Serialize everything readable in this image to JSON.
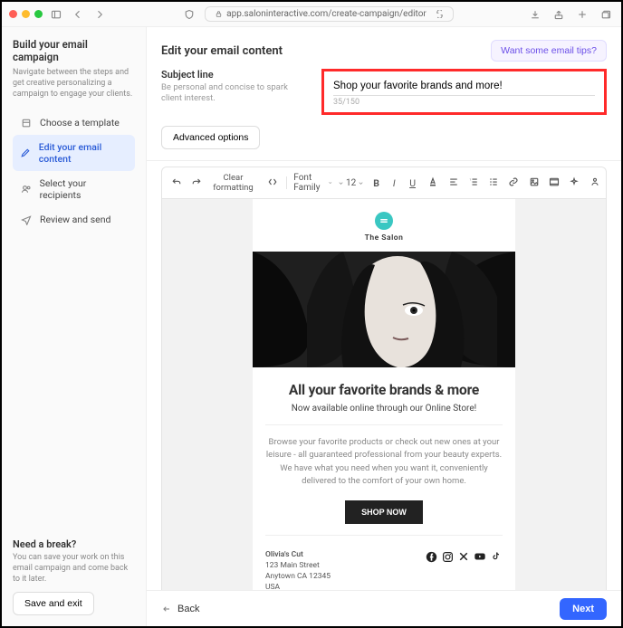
{
  "browser": {
    "url": "app.saloninteractive.com/create-campaign/editor"
  },
  "sidebar": {
    "title": "Build your email campaign",
    "subtitle": "Navigate between the steps and get creative personalizing a campaign to engage your clients.",
    "items": [
      {
        "label": "Choose a template"
      },
      {
        "label": "Edit your email content"
      },
      {
        "label": "Select your recipients"
      },
      {
        "label": "Review and send"
      }
    ],
    "break_title": "Need a break?",
    "break_sub": "You can save your work on this email campaign and come back to it later.",
    "save_exit": "Save and exit"
  },
  "main": {
    "heading": "Edit your email content",
    "tips_label": "Want some email tips?",
    "subject": {
      "label": "Subject line",
      "help": "Be personal and concise to spark client interest.",
      "value": "Shop your favorite brands and more!",
      "counter": "35/150"
    },
    "advanced_label": "Advanced options",
    "toolbar": {
      "clear": "Clear formatting",
      "font_family": "Font Family",
      "font_size": "12"
    },
    "email": {
      "salon_name": "The Salon",
      "headline": "All your favorite brands & more",
      "sub": "Now available online through our Online Store!",
      "paragraph": "Browse your favorite products or check out new ones at your leisure - all guaranteed professional from your beauty experts. We have what you need when you want it, conveniently delivered to the comfort of your own home.",
      "cta": "SHOP NOW",
      "business": "Olivia's Cut",
      "addr1": "123 Main Street",
      "addr2": "Anytown CA 12345",
      "addr3": "USA"
    }
  },
  "bottom": {
    "back": "Back",
    "next": "Next"
  }
}
